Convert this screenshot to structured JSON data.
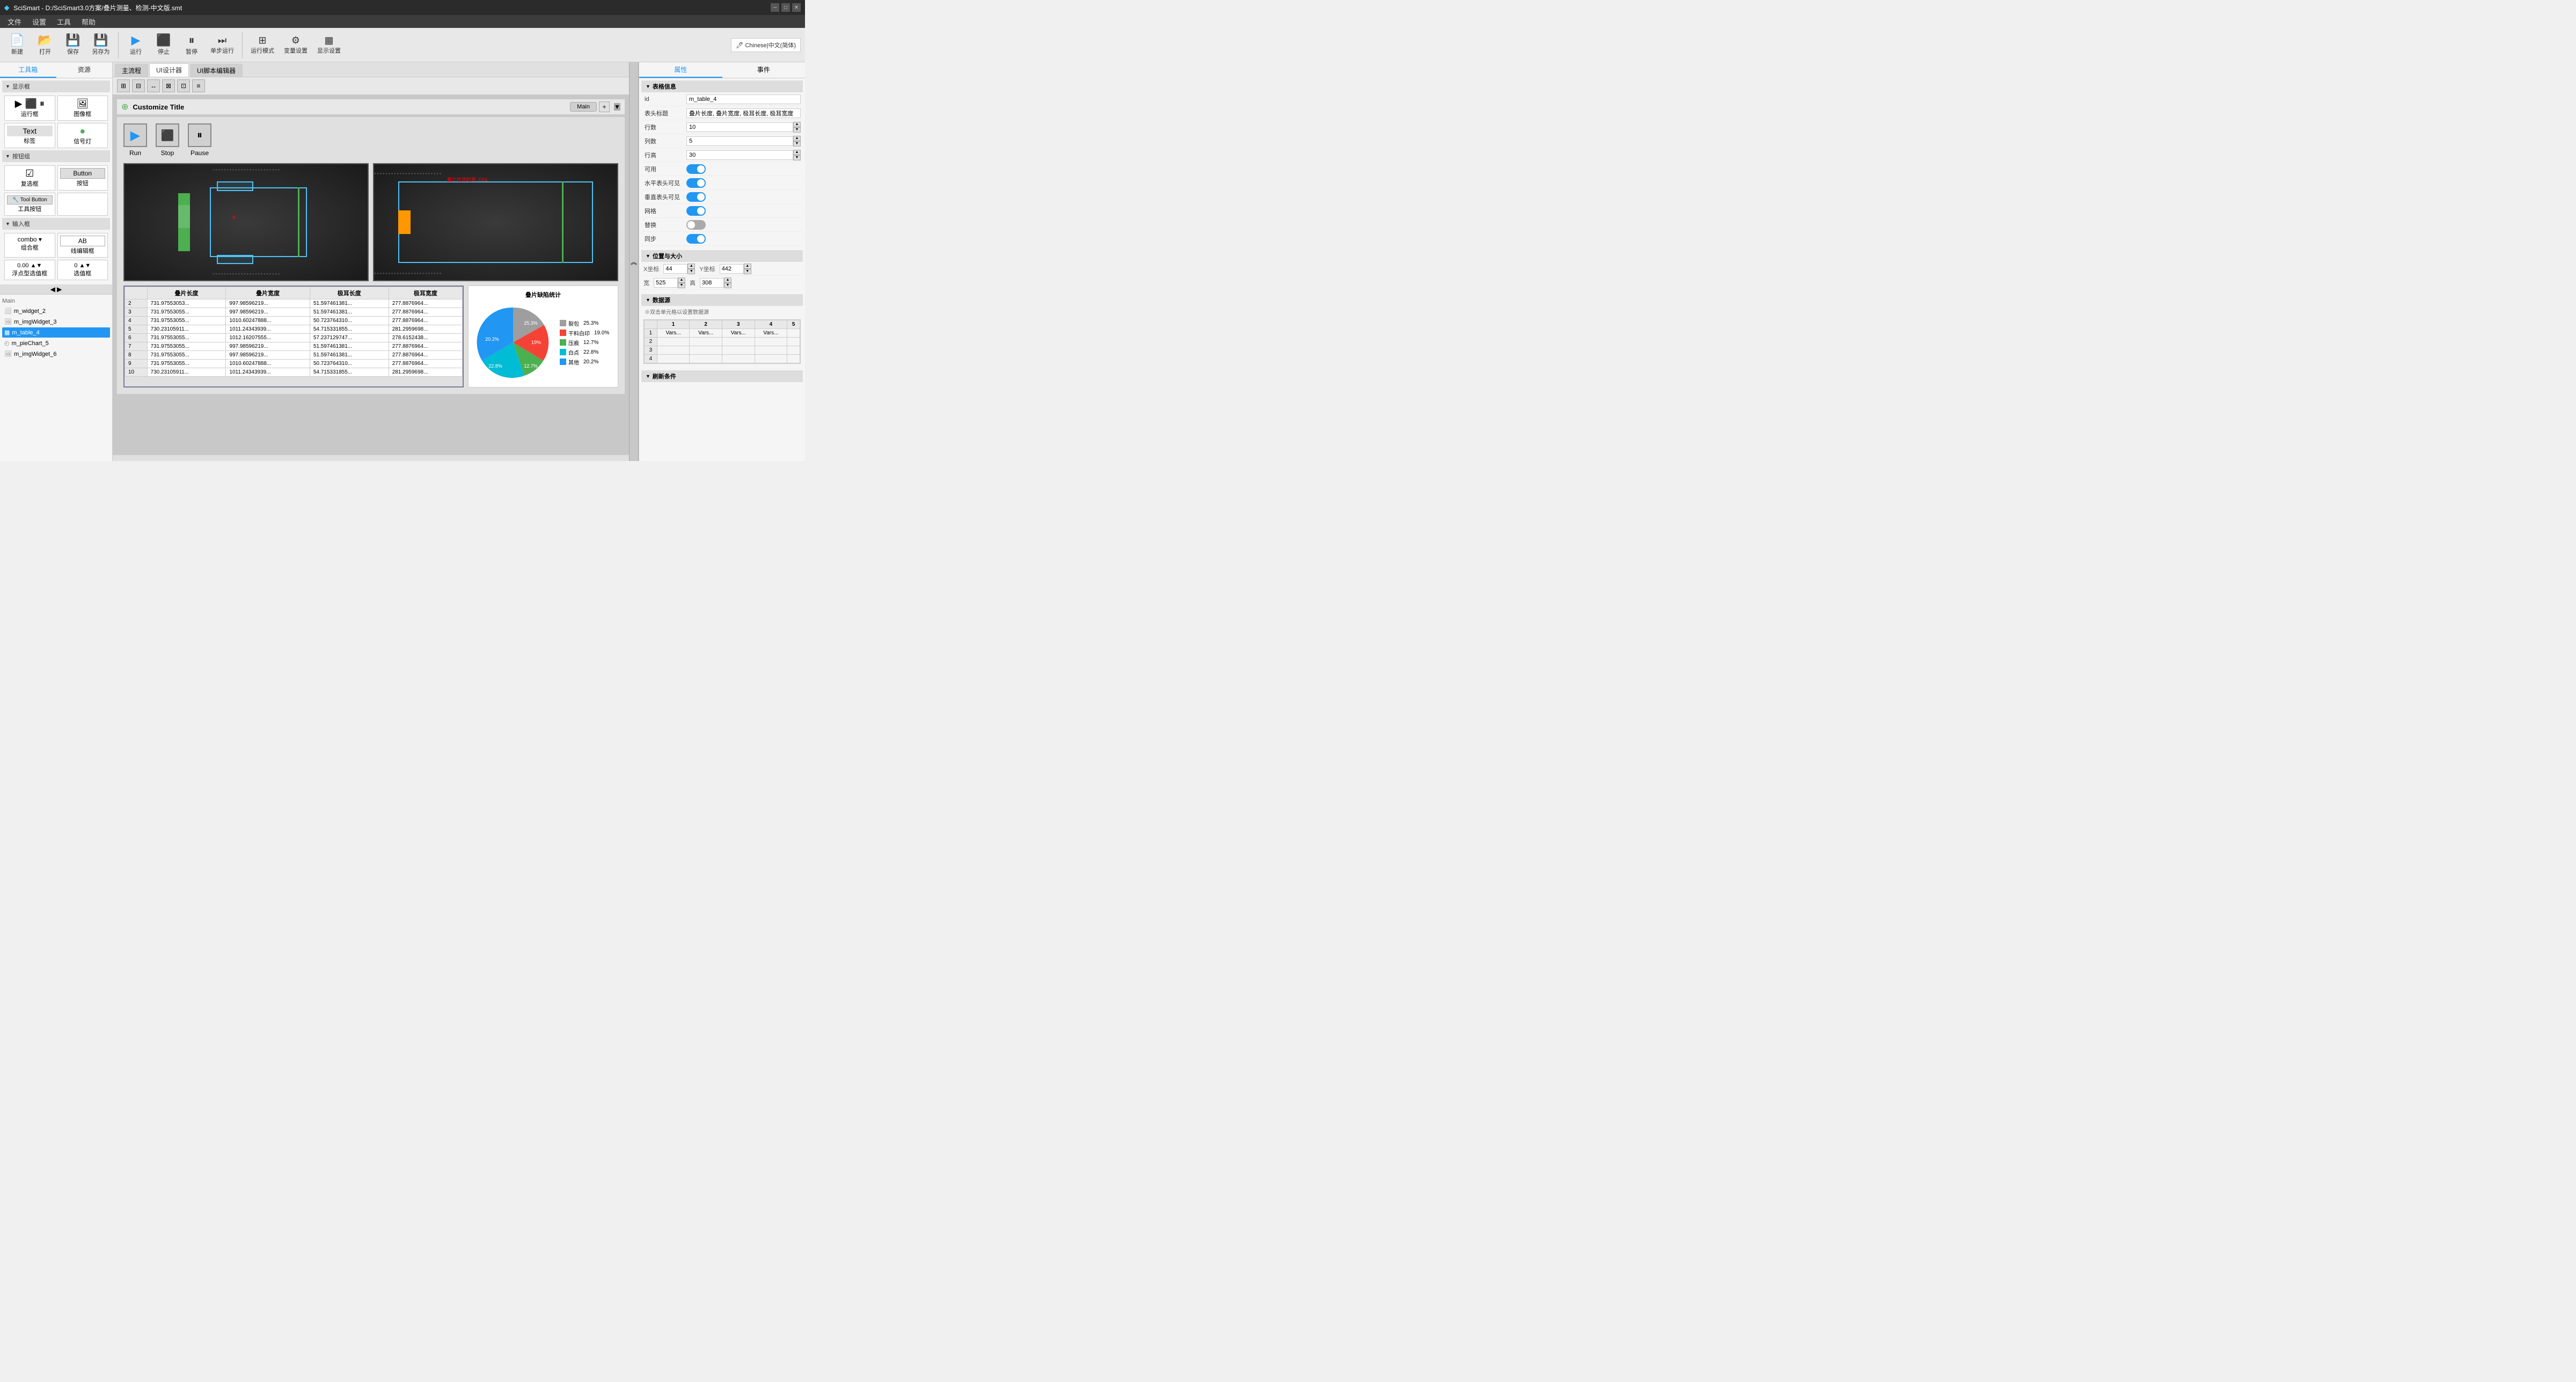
{
  "titleBar": {
    "logo": "◆",
    "title": "SciSmart - D:/SciSmart3.0方案/叠片测量、检测-中文版.smt",
    "winMin": "─",
    "winMax": "□",
    "winClose": "✕"
  },
  "menuBar": {
    "items": [
      "文件",
      "设置",
      "工具",
      "帮助"
    ]
  },
  "toolbar": {
    "buttons": [
      {
        "id": "new",
        "icon": "📄",
        "label": "新建"
      },
      {
        "id": "open",
        "icon": "📂",
        "label": "打开"
      },
      {
        "id": "save",
        "icon": "💾",
        "label": "保存"
      },
      {
        "id": "saveas",
        "icon": "💾",
        "label": "另存为"
      },
      {
        "id": "run",
        "icon": "▶",
        "label": "运行"
      },
      {
        "id": "stop",
        "icon": "⬛",
        "label": "停止"
      },
      {
        "id": "pause",
        "icon": "⏸",
        "label": "暂停"
      },
      {
        "id": "step",
        "icon": "▶|",
        "label": "单步运行"
      },
      {
        "id": "mode",
        "icon": "⊞",
        "label": "运行模式"
      },
      {
        "id": "var",
        "icon": "⚙",
        "label": "变量设置"
      },
      {
        "id": "display",
        "icon": "▦",
        "label": "显示设置"
      }
    ],
    "lang": "Chinese|中文(简体)"
  },
  "leftPanel": {
    "tabs": [
      "工具箱",
      "资源"
    ],
    "activeTab": "工具箱",
    "sections": [
      {
        "title": "▼ 显示框",
        "items": [
          {
            "icon": "▶",
            "label": "运行框"
          },
          {
            "icon": "🖼",
            "label": "图像框"
          },
          {
            "icon": "T",
            "label": "标签"
          },
          {
            "icon": "●",
            "label": "信号灯"
          }
        ]
      },
      {
        "title": "▼ 按钮组",
        "items": [
          {
            "icon": "☑",
            "label": "复选框"
          },
          {
            "icon": "▭",
            "label": "按钮"
          },
          {
            "icon": "🔧",
            "label": "工具按钮"
          },
          {
            "icon": "",
            "label": ""
          }
        ]
      },
      {
        "title": "▼ 输入框",
        "items": [
          {
            "icon": "▾",
            "label": "组合框"
          },
          {
            "icon": "━",
            "label": "线编辑框"
          },
          {
            "icon": "0.00",
            "label": "浮点型选值框"
          },
          {
            "icon": "0",
            "label": "选值框"
          }
        ]
      }
    ],
    "treeTitle": "Main",
    "treeItems": [
      {
        "id": "m_widget_2",
        "icon": "⬜",
        "label": "m_widget_2",
        "color": "#888"
      },
      {
        "id": "m_imgWidget_3",
        "icon": "🖼",
        "label": "m_imgWidget_3",
        "color": "#888"
      },
      {
        "id": "m_table_4",
        "icon": "▦",
        "label": "m_table_4",
        "color": "#2196F3",
        "active": true
      },
      {
        "id": "m_pieChart_5",
        "icon": "◴",
        "label": "m_pieChart_5",
        "color": "#888"
      },
      {
        "id": "m_imgWidget_6",
        "icon": "🖼",
        "label": "m_imgWidget_6",
        "color": "#888"
      }
    ]
  },
  "subTabs": [
    "主流程",
    "UI设计器",
    "UI脚本编辑器"
  ],
  "activeSubTab": "UI设计器",
  "canvasTabs": [
    "Main"
  ],
  "canvasTitle": "Customize Title",
  "rspButtons": [
    {
      "id": "run",
      "icon": "▶",
      "label": "Run"
    },
    {
      "id": "stop",
      "icon": "⬛",
      "label": "Stop"
    },
    {
      "id": "pause",
      "icon": "⏸",
      "label": "Pause"
    }
  ],
  "tableData": {
    "headers": [
      "叠片长度",
      "叠片宽度",
      "极耳长度",
      "极耳宽度"
    ],
    "rows": [
      [
        "731.97553053...",
        "997.98596219...",
        "51.597461381...",
        "277.8876964..."
      ],
      [
        "731.97553055...",
        "997.98596219...",
        "51.597461381...",
        "277.8876964..."
      ],
      [
        "731.97553055...",
        "1010.60247888...",
        "50.723764310...",
        "277.8876964..."
      ],
      [
        "730.23105911...",
        "1011.24343939...",
        "54.715331855...",
        "281.2959698..."
      ],
      [
        "731.97553055...",
        "1012.16207555...",
        "57.237129747...",
        "278.6152438..."
      ],
      [
        "731.97553055...",
        "997.98596219...",
        "51.597461381...",
        "277.8876964..."
      ],
      [
        "731.97553055...",
        "997.98596219...",
        "51.597461381...",
        "277.8876964..."
      ],
      [
        "731.97553055...",
        "1010.60247888...",
        "50.723764310...",
        "277.8876964..."
      ],
      [
        "730.23105911...",
        "1011.24343939...",
        "54.715331855...",
        "281.2959698..."
      ]
    ],
    "rowNums": [
      2,
      3,
      4,
      5,
      6,
      7,
      8,
      9,
      10
    ]
  },
  "pieChart": {
    "title": "叠片缺陷统计",
    "segments": [
      {
        "label": "裂包",
        "color": "#9e9e9e",
        "percent": "25.3%",
        "value": 25.3
      },
      {
        "label": "干料白印",
        "color": "#f44336",
        "percent": "19.0%",
        "value": 19.0
      },
      {
        "label": "压痕",
        "color": "#4caf50",
        "percent": "12.7%",
        "value": 12.7
      },
      {
        "label": "白点",
        "color": "#00bcd4",
        "percent": "22.8%",
        "value": 22.8
      },
      {
        "label": "其他",
        "color": "#2196f3",
        "percent": "20.2%",
        "value": 20.2
      }
    ]
  },
  "rightPanel": {
    "tabs": [
      "属性",
      "事件"
    ],
    "activeTab": "属性",
    "tableInfo": {
      "sectionTitle": "表格信息",
      "id": "m_table_4",
      "idLabel": "id",
      "headerLabel": "表头标题",
      "headerValue": "叠片长度, 叠片宽度, 极耳长度, 极耳宽度",
      "rowsLabel": "行数",
      "rowsValue": "10",
      "colsLabel": "列数",
      "colsValue": "5",
      "rowHeightLabel": "行高",
      "rowHeightValue": "30",
      "enabledLabel": "可用",
      "hHeaderLabel": "水平表头可见",
      "vHeaderLabel": "垂直表头可见",
      "gridLabel": "网格",
      "replaceLabel": "替换",
      "syncLabel": "同步"
    },
    "posSize": {
      "sectionTitle": "位置与大小",
      "xLabel": "X坐标",
      "xValue": "44",
      "yLabel": "Y坐标",
      "yValue": "442",
      "wLabel": "宽",
      "wValue": "525",
      "hLabel": "高",
      "hValue": "308"
    },
    "dataSource": {
      "sectionTitle": "数据源",
      "hint": "※双击单元格以设置数据源",
      "cols": [
        1,
        2,
        3,
        4,
        5
      ],
      "rows": [
        {
          "num": 1,
          "cells": [
            "Vars...",
            "Vars...",
            "Vars...",
            "Vars...",
            ""
          ]
        },
        {
          "num": 2,
          "cells": [
            "",
            "",
            "",
            "",
            ""
          ]
        },
        {
          "num": 3,
          "cells": [
            "",
            "",
            "",
            "",
            ""
          ]
        },
        {
          "num": 4,
          "cells": [
            "",
            "",
            "",
            "",
            ""
          ]
        }
      ]
    },
    "refreshLabel": "刷新条件"
  }
}
